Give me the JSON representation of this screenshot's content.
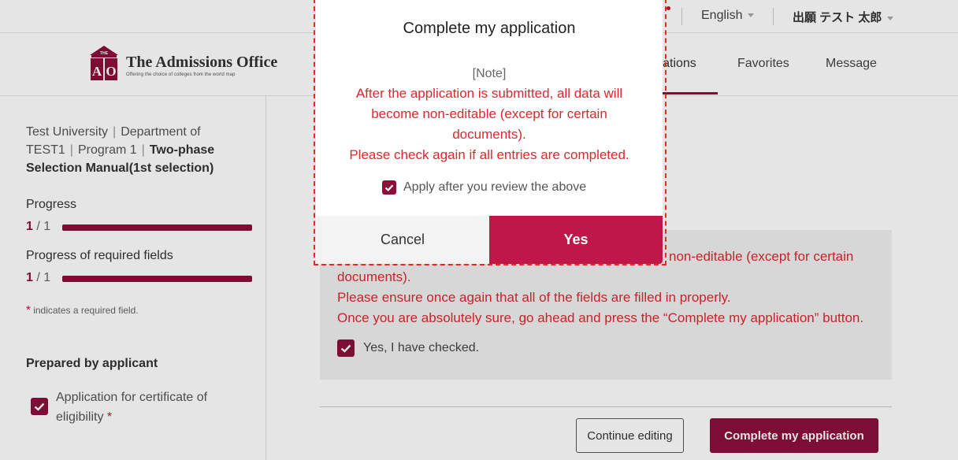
{
  "topbar": {
    "language": "English",
    "user_name": "出願 テスト 太郎"
  },
  "header": {
    "logo_mark": "THE AO",
    "brand": "The Admissions Office",
    "brand_tagline": "Offering the choice of colleges from the world map",
    "nav": {
      "applications": "lications",
      "favorites": "Favorites",
      "message": "Message"
    }
  },
  "sidebar": {
    "breadcrumb": {
      "university": "Test University",
      "department": "Department of TEST1",
      "program": "Program 1",
      "selection": "Two-phase Selection Manual(1st selection)"
    },
    "progress": {
      "label": "Progress",
      "current": "1",
      "total": "/ 1",
      "fraction": 1.0
    },
    "required_progress": {
      "label": "Progress of required fields",
      "current": "1",
      "total": "/ 1",
      "fraction": 1.0
    },
    "required_note_star": "*",
    "required_note": "indicates a required field.",
    "prepared_title": "Prepared by applicant",
    "documents": [
      {
        "label": "Application for certificate of eligibility",
        "required_star": "*",
        "checked": true
      }
    ]
  },
  "main": {
    "confirm_lines": [
      "non-editable (except for certain",
      "documents).",
      "Please ensure once again that all of the fields are filled in properly.",
      "Once you are absolutely sure, go ahead and press the “Complete my application” button."
    ],
    "confirm_checkbox_label": "Yes, I have checked.",
    "continue_button": "Continue editing",
    "complete_button": "Complete my application"
  },
  "modal": {
    "title": "Complete my application",
    "note_label": "[Note]",
    "body": "After the application is submitted, all data will become non-editable (except for certain documents).",
    "body_2": "Please check again if all entries are completed.",
    "checkbox_label": "Apply after you review the above",
    "cancel_button": "Cancel",
    "yes_button": "Yes"
  },
  "colors": {
    "accent": "#8b0f3a",
    "yes_button": "#c01749",
    "warning_text": "#e0262d"
  }
}
